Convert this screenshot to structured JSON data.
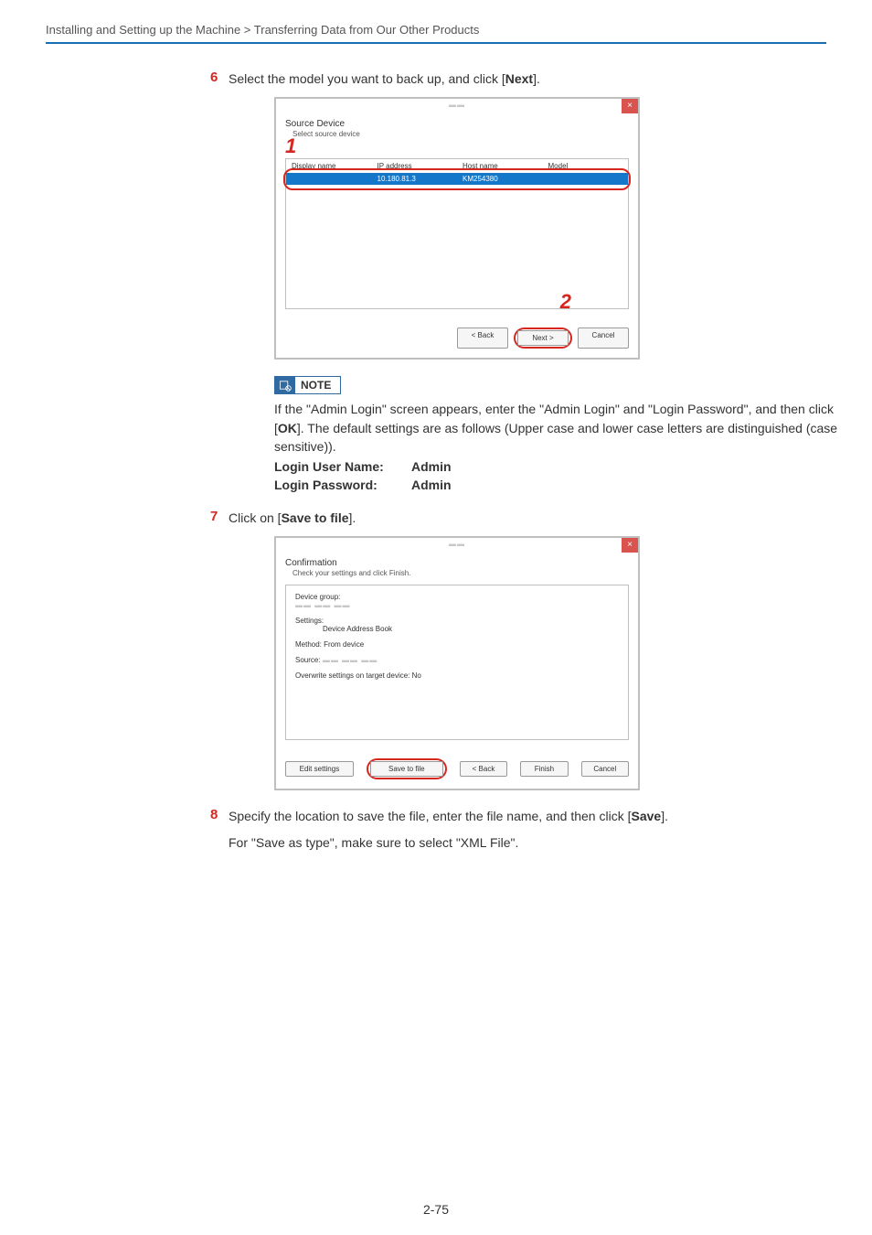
{
  "breadcrumb": "Installing and Setting up the Machine > Transferring Data from Our Other Products",
  "steps": {
    "s6": {
      "num": "6",
      "pre": "Select the model you want to back up, and click [",
      "bold": "Next",
      "post": "]."
    },
    "s7": {
      "num": "7",
      "pre": "Click on [",
      "bold": "Save to file",
      "post": "]."
    },
    "s8": {
      "num": "8",
      "line1_pre": "Specify the location to save the file, enter the file name, and then click [",
      "line1_bold": "Save",
      "line1_post": "].",
      "line2": "For \"Save as type\", make sure to select \"XML File\"."
    }
  },
  "win1": {
    "close": "×",
    "title": "Source Device",
    "sub": "Select source device",
    "marker1": "1",
    "marker2": "2",
    "headers": {
      "dn": "Display name",
      "ip": "IP address",
      "hn": "Host name",
      "md": "Model"
    },
    "row": {
      "dn": "",
      "ip": "10.180.81.3",
      "hn": "KM254380",
      "md": ""
    },
    "buttons": {
      "back": "< Back",
      "next": "Next >",
      "cancel": "Cancel"
    }
  },
  "note": {
    "label": "NOTE",
    "para_pre": "If the \"Admin Login\" screen appears, enter the \"Admin Login\" and \"Login Password\", and then click [",
    "para_bold": "OK",
    "para_post": "]. The default settings are as follows (Upper case and lower case letters are distinguished (case sensitive)).",
    "creds": [
      {
        "label": "Login User Name:",
        "value": "Admin"
      },
      {
        "label": "Login Password:",
        "value": "Admin"
      }
    ]
  },
  "win2": {
    "close": "×",
    "title": "Confirmation",
    "sub": "Check your settings and click Finish.",
    "kv": {
      "devgroup_l": "Device group:",
      "settings_l": "Settings:",
      "settings_v": "Device Address Book",
      "method_l": "Method: From device",
      "source_l": "Source:",
      "overwrite_l": "Overwrite settings on target device: No"
    },
    "buttons": {
      "edit": "Edit settings",
      "save": "Save to file",
      "back": "< Back",
      "finish": "Finish",
      "cancel": "Cancel"
    }
  },
  "page_number": "2-75"
}
